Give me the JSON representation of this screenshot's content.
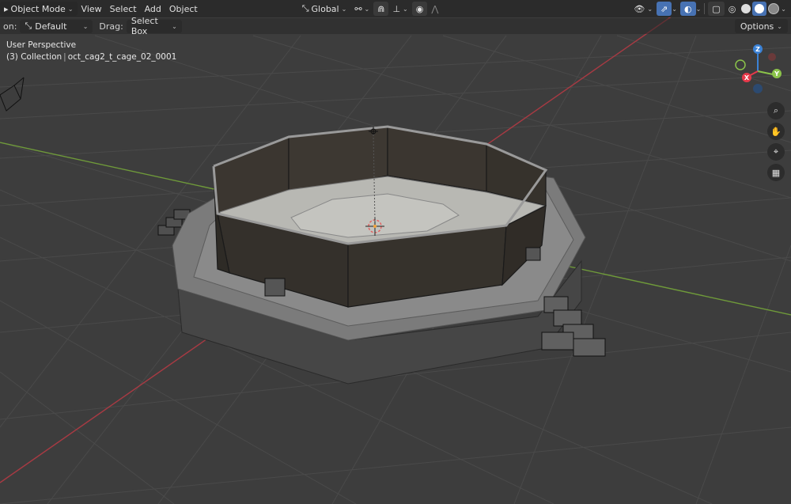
{
  "header": {
    "mode": "Object Mode",
    "menus": [
      "View",
      "Select",
      "Add",
      "Object"
    ],
    "orientation": "Global"
  },
  "toolbar": {
    "orientation_label": "on:",
    "orientation_value": "Default",
    "drag_label": "Drag:",
    "drag_value": "Select Box",
    "options": "Options"
  },
  "viewport": {
    "view_name": "User Perspective",
    "collection": "(3) Collection",
    "object_name": "oct_cag2_t_cage_02_0001"
  },
  "gizmo": {
    "z": "Z",
    "y": "Y",
    "x": "X"
  },
  "colors": {
    "x_axis": "#e6394a",
    "y_axis": "#8bc34a",
    "z_axis": "#3b82d6",
    "accent": "#4772b3"
  },
  "icons": [
    "editor-type-icon",
    "orientation-icon",
    "pivot-icon",
    "snap-icon",
    "proportional-icon",
    "visibility-icon",
    "gizmo-icon",
    "overlay-icon",
    "xray-icon",
    "shading-wire",
    "shading-solid",
    "shading-material",
    "shading-render",
    "zoom-icon",
    "hand-icon",
    "camera-icon",
    "grid-icon"
  ]
}
